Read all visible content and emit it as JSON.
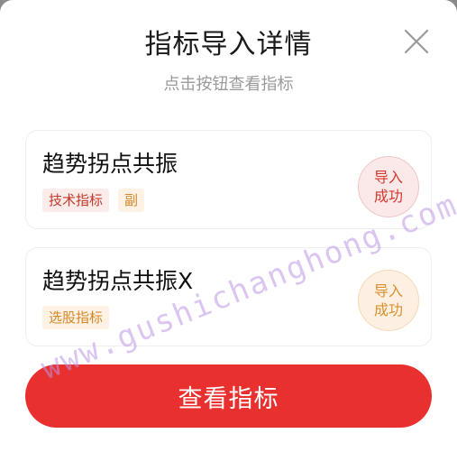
{
  "dialog": {
    "title": "指标导入详情",
    "subtitle": "点击按钮查看指标",
    "close_icon": "close-icon"
  },
  "indicators": [
    {
      "name": "趋势拐点共振",
      "tags": [
        "技术指标",
        "副"
      ],
      "status_line1": "导入",
      "status_line2": "成功",
      "status_color": "#d23a2e"
    },
    {
      "name": "趋势拐点共振X",
      "tags": [
        "选股指标"
      ],
      "status_line1": "导入",
      "status_line2": "成功",
      "status_color": "#d8912e"
    }
  ],
  "action": {
    "view_label": "查看指标"
  },
  "watermark": {
    "text": "www.gushichanghong.com"
  },
  "colors": {
    "primary": "#e8312f",
    "tag_red": "#c0392b",
    "tag_orange": "#d4882a"
  }
}
